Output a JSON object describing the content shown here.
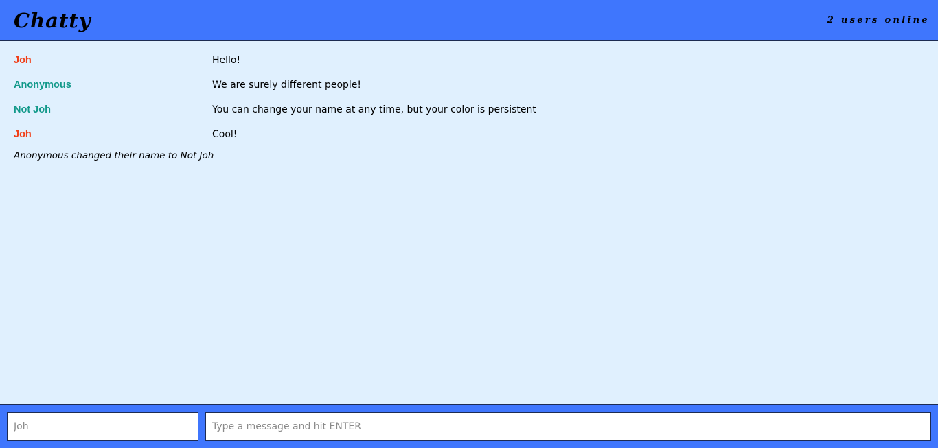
{
  "navbar": {
    "brand": "Chatty",
    "user_count": "2 users online"
  },
  "colors": {
    "bar_background": "#3f76fd",
    "page_background": "#e0f0fe",
    "user_joh": "#f0401a",
    "user_not_joh": "#12998a"
  },
  "messages": [
    {
      "username": "Joh",
      "content": "Hello!",
      "color": "#f0401a"
    },
    {
      "username": "Anonymous",
      "content": "We are surely different people!",
      "color": "#12998a"
    },
    {
      "username": "Not Joh",
      "content": "You can change your name at any time, but your color is persistent",
      "color": "#12998a"
    },
    {
      "username": "Joh",
      "content": "Cool!",
      "color": "#f0401a"
    }
  ],
  "notification": "Anonymous changed their name to Not Joh",
  "chatbar": {
    "username_placeholder": "Joh",
    "username_value": "",
    "message_placeholder": "Type a message and hit ENTER",
    "message_value": ""
  }
}
